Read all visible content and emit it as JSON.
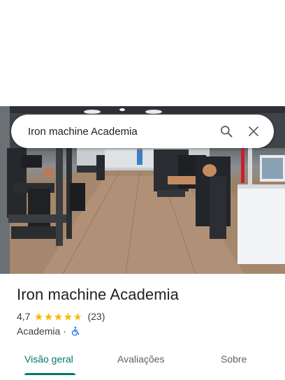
{
  "search": {
    "query": "Iron machine Academia",
    "search_icon": "search-icon",
    "close_icon": "close-icon"
  },
  "photo": {
    "subject": "gym-interior-photo"
  },
  "place": {
    "title": "Iron machine Academia",
    "rating": "4,7",
    "stars_fraction": 0.94,
    "review_count": "(23)",
    "category": "Academia",
    "separator": "·",
    "accessibility_icon": "wheelchair-icon"
  },
  "tabs": [
    {
      "label": "Visão geral",
      "active": true
    },
    {
      "label": "Avaliações",
      "active": false
    },
    {
      "label": "Sobre",
      "active": false
    }
  ],
  "colors": {
    "accent": "#00796b",
    "star": "#fbbc04",
    "accessibility": "#1a73e8"
  }
}
